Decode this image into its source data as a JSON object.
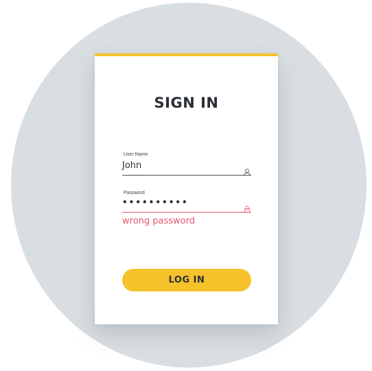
{
  "form": {
    "title": "SIGN IN",
    "username": {
      "label": "User Name",
      "value": "John",
      "icon": "user-icon"
    },
    "password": {
      "label": "Password",
      "masked_value": "••••••••••",
      "icon": "lock-icon",
      "error": "wrong password"
    },
    "submit_label": "LOG IN"
  },
  "colors": {
    "accent": "#f5c22c",
    "error": "#e4566b",
    "text": "#2a2f36",
    "background_circle": "#d9dee2",
    "card": "#ffffff"
  }
}
